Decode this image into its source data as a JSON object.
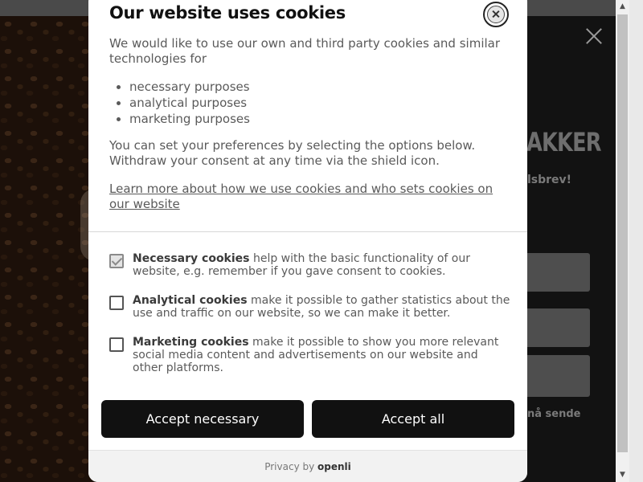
{
  "background": {
    "headline": "AKKER",
    "subtext": "lsbrev!",
    "note": "nå sende"
  },
  "dialog": {
    "title": "Our website uses cookies",
    "intro": "We would like to use our own and third party cookies and similar technologies for",
    "purposes": [
      "necessary purposes",
      "analytical purposes",
      "marketing purposes"
    ],
    "preferences_text": "You can set your preferences by selecting the options below. Withdraw your consent at any time via the shield icon.",
    "learn_more_link": "Learn more about how we use cookies and who sets cookies on our website",
    "options": [
      {
        "title": "Necessary cookies",
        "description": "help with the basic functionality of our website, e.g. remember if you gave consent to cookies.",
        "checked": true,
        "disabled": true
      },
      {
        "title": "Analytical cookies",
        "description": "make it possible to gather statistics about the use and traffic on our website, so we can make it better.",
        "checked": false
      },
      {
        "title": "Marketing cookies",
        "description": "make it possible to show you more relevant social media content and advertisements on our website and other platforms.",
        "checked": false
      }
    ],
    "accept_necessary_label": "Accept necessary",
    "accept_all_label": "Accept all",
    "footer_prefix": "Privacy by",
    "footer_brand": "openli"
  },
  "icons": {
    "close": "close-icon",
    "checkbox_checked": "check-icon",
    "scroll_up": "scroll-up-arrow-icon",
    "scroll_down": "scroll-down-arrow-icon"
  }
}
